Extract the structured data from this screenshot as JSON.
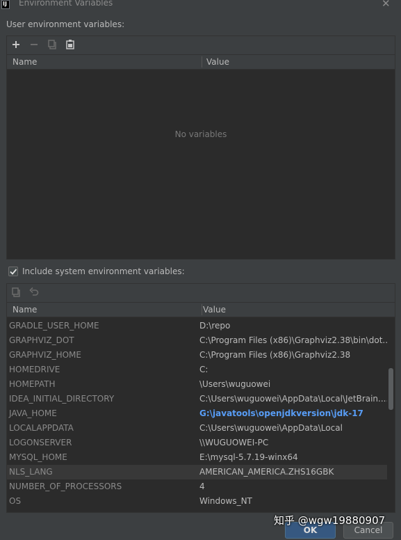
{
  "window": {
    "title": "Environment Variables",
    "icon": "intellij-idea-icon"
  },
  "user_section": {
    "label": "User environment variables:",
    "toolbar": [
      "add-icon",
      "remove-icon",
      "copy-icon",
      "paste-icon"
    ],
    "columns": [
      "Name",
      "Value"
    ],
    "empty_text": "No variables"
  },
  "system_section": {
    "checkbox_label": "Include system environment variables:",
    "checked": true,
    "toolbar": [
      "copy-icon",
      "undo-icon"
    ],
    "columns": [
      "Name",
      "Value"
    ],
    "rows": [
      {
        "name": "GRADLE_USER_HOME",
        "value": "D:\\repo"
      },
      {
        "name": "GRAPHVIZ_DOT",
        "value": "C:\\Program Files (x86)\\Graphviz2.38\\bin\\dot...."
      },
      {
        "name": "GRAPHVIZ_HOME",
        "value": "C:\\Program Files (x86)\\Graphviz2.38"
      },
      {
        "name": "HOMEDRIVE",
        "value": "C:"
      },
      {
        "name": "HOMEPATH",
        "value": "\\Users\\wuguowei"
      },
      {
        "name": "IDEA_INITIAL_DIRECTORY",
        "value": "C:\\Users\\wuguowei\\AppData\\Local\\JetBrain...."
      },
      {
        "name": "JAVA_HOME",
        "value": "G:\\javatools\\openjdkversion\\jdk-17",
        "highlight": true
      },
      {
        "name": "LOCALAPPDATA",
        "value": "C:\\Users\\wuguowei\\AppData\\Local"
      },
      {
        "name": "LOGONSERVER",
        "value": "\\\\WUGUOWEI-PC"
      },
      {
        "name": "MYSQL_HOME",
        "value": "E:\\mysql-5.7.19-winx64"
      },
      {
        "name": "NLS_LANG",
        "value": "AMERICAN_AMERICA.ZHS16GBK",
        "selected": true
      },
      {
        "name": "NUMBER_OF_PROCESSORS",
        "value": "4"
      },
      {
        "name": "OS",
        "value": "Windows_NT"
      }
    ]
  },
  "buttons": {
    "ok": "OK",
    "cancel": "Cancel"
  },
  "watermark": "知乎 @wgw19880907",
  "colors": {
    "background": "#3c3f41",
    "table_bg": "#2b2b2b",
    "highlight": "#589df6",
    "ok_button": "#365880"
  }
}
